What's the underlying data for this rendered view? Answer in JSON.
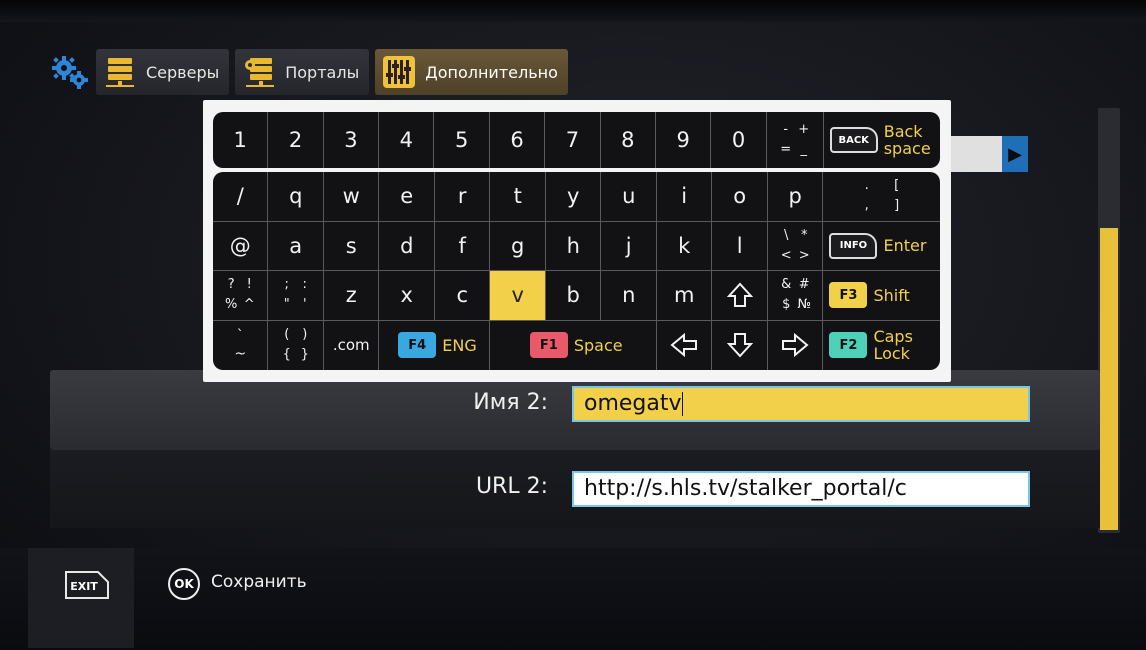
{
  "tabs": [
    {
      "label": "Серверы",
      "icon": "server-icon",
      "active": false
    },
    {
      "label": "Порталы",
      "icon": "portal-icon",
      "active": false
    },
    {
      "label": "Дополнительно",
      "icon": "sliders-icon",
      "active": true
    }
  ],
  "colors": {
    "accent": "#f2d04a",
    "selection": "#78c6e8",
    "f1": "#e85a6a",
    "f2": "#4fd0b8",
    "f3": "#f2d04a",
    "f4": "#3aa8e0"
  },
  "keyboard": {
    "row_numbers": [
      "1",
      "2",
      "3",
      "4",
      "5",
      "6",
      "7",
      "8",
      "9",
      "0"
    ],
    "num_symbols": [
      "-",
      "+",
      "=",
      "_"
    ],
    "backspace": {
      "badge": "BACK",
      "label_line1": "Back",
      "label_line2": "space"
    },
    "row_q": [
      "/",
      "q",
      "w",
      "e",
      "r",
      "t",
      "y",
      "u",
      "i",
      "o",
      "p"
    ],
    "row_q_sym": [
      ".",
      "[",
      ",",
      "]"
    ],
    "row_a": [
      "@",
      "a",
      "s",
      "d",
      "f",
      "g",
      "h",
      "j",
      "k",
      "l"
    ],
    "row_a_sym": [
      "\\",
      "*",
      "<",
      ">"
    ],
    "enter": {
      "badge": "INFO",
      "label": "Enter"
    },
    "row_z_sym1": [
      "?",
      "!",
      "%",
      "^"
    ],
    "row_z_sym2": [
      ";",
      ":",
      "\"",
      "'"
    ],
    "row_z": [
      "z",
      "x",
      "c",
      "v",
      "b",
      "n",
      "m"
    ],
    "row_z_sym3": [
      "&",
      "#",
      "$",
      "№"
    ],
    "shift": {
      "badge": "F3",
      "label": "Shift"
    },
    "bottom_sym1": [
      "`",
      "~"
    ],
    "bottom_sym2": [
      "(",
      ")",
      "{",
      "}"
    ],
    "dotcom": ".com",
    "lang": {
      "badge": "F4",
      "label": "ENG"
    },
    "space": {
      "badge": "F1",
      "label": "Space"
    },
    "caps": {
      "badge": "F2",
      "label_line1": "Caps",
      "label_line2": "Lock"
    }
  },
  "form": {
    "name_label": "Имя 2:",
    "name_value": "omegatv",
    "url_label": "URL 2:",
    "url_value": "http://s.hls.tv/stalker_portal/c"
  },
  "footer": {
    "exit_badge": "EXIT",
    "ok_badge": "OK",
    "save_label": "Сохранить"
  }
}
